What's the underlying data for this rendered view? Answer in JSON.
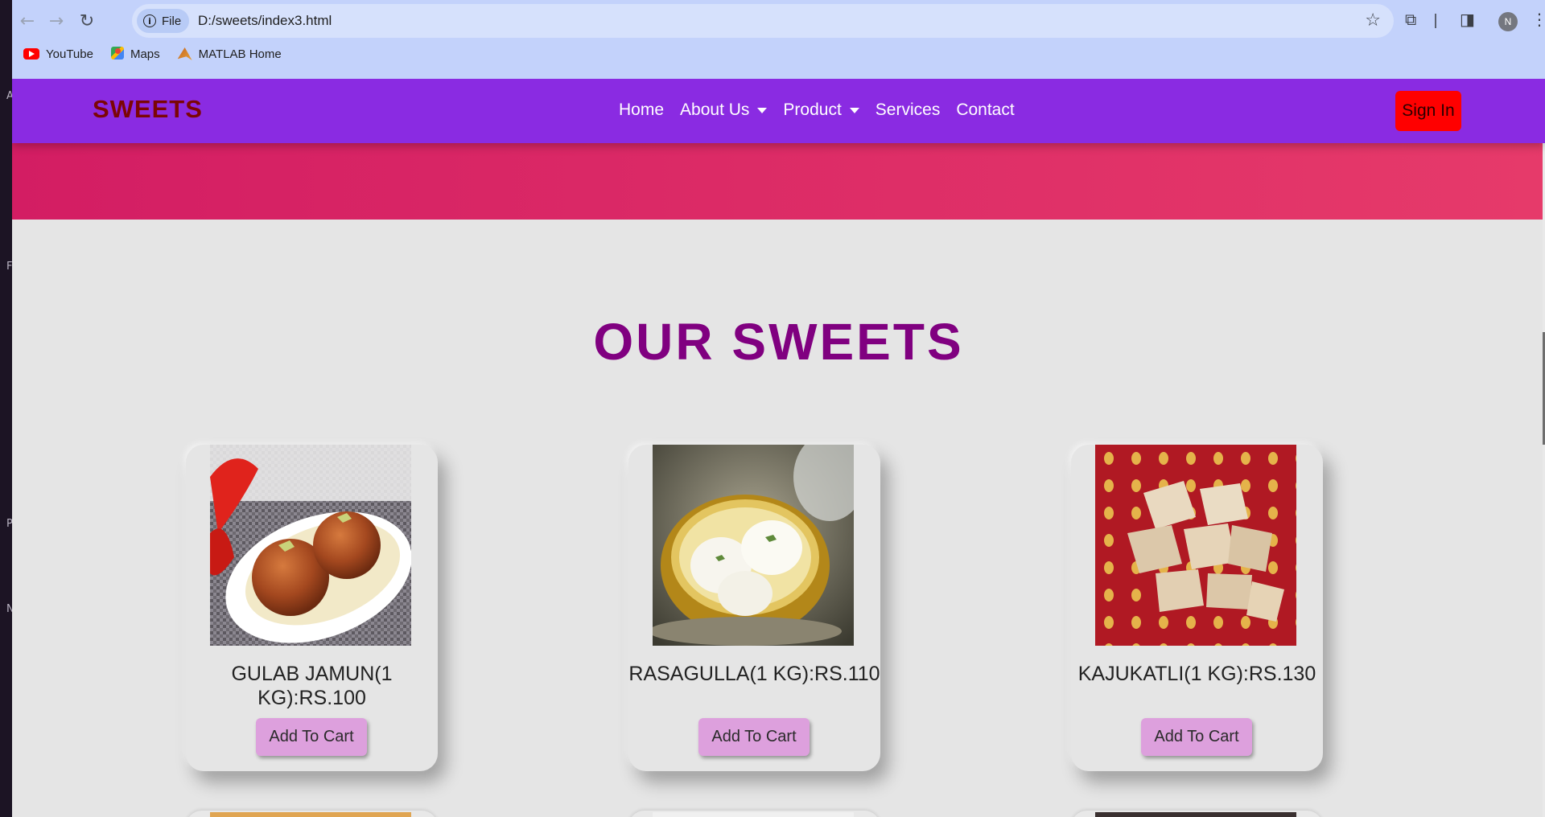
{
  "browser": {
    "url": "D:/sweets/index3.html",
    "chip_label": "File",
    "profile_initial": "N",
    "bookmarks": [
      {
        "label": "YouTube",
        "icon": "youtube-icon"
      },
      {
        "label": "Maps",
        "icon": "maps-icon"
      },
      {
        "label": "MATLAB Home",
        "icon": "matlab-icon"
      }
    ]
  },
  "site": {
    "brand": "SWEETS",
    "nav": [
      "Home",
      "About Us",
      "Product",
      "Services",
      "Contact"
    ],
    "signin_label": "Sign In",
    "section_title": "OUR SWEETS",
    "products": [
      {
        "name": "GULAB JAMUN(1 KG):RS.100",
        "button": "Add To Cart"
      },
      {
        "name": "RASAGULLA(1 KG):RS.110",
        "button": "Add To Cart"
      },
      {
        "name": "KAJUKATLI(1 KG):RS.130",
        "button": "Add To Cart"
      }
    ]
  },
  "colors": {
    "navbar": "#8a2be2",
    "brand": "#7b0505",
    "signin": "#ff0000",
    "hero_start": "#d31d63",
    "hero_end": "#e63a6a",
    "title": "#800080",
    "cart_button": "#dda0dd"
  }
}
